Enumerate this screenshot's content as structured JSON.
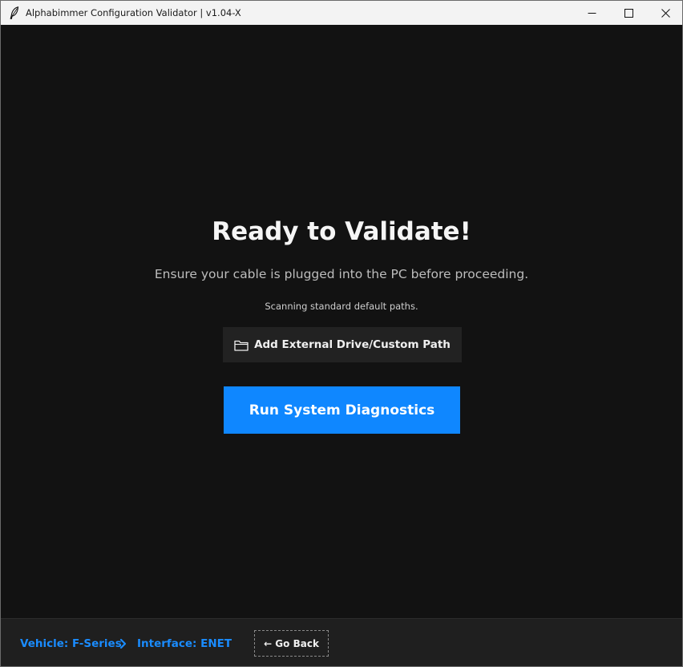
{
  "window": {
    "title": "Alphabimmer Configuration Validator | v1.04-X"
  },
  "main": {
    "heading": "Ready to Validate!",
    "instruction": "Ensure your cable is plugged into the PC before proceeding.",
    "scan_status": "Scanning standard default paths.",
    "add_path_button": {
      "label": "Add External Drive/Custom Path",
      "icon": "folder-icon"
    },
    "run_button_label": "Run System Diagnostics"
  },
  "footer": {
    "vehicle": "Vehicle: F-Series",
    "interface": "Interface: ENET",
    "back_button_label": "← Go Back"
  },
  "colors": {
    "accent": "#0f87ff",
    "breadcrumb": "#1a8cff",
    "background": "#121212",
    "footer_background": "#1f1f1f"
  }
}
